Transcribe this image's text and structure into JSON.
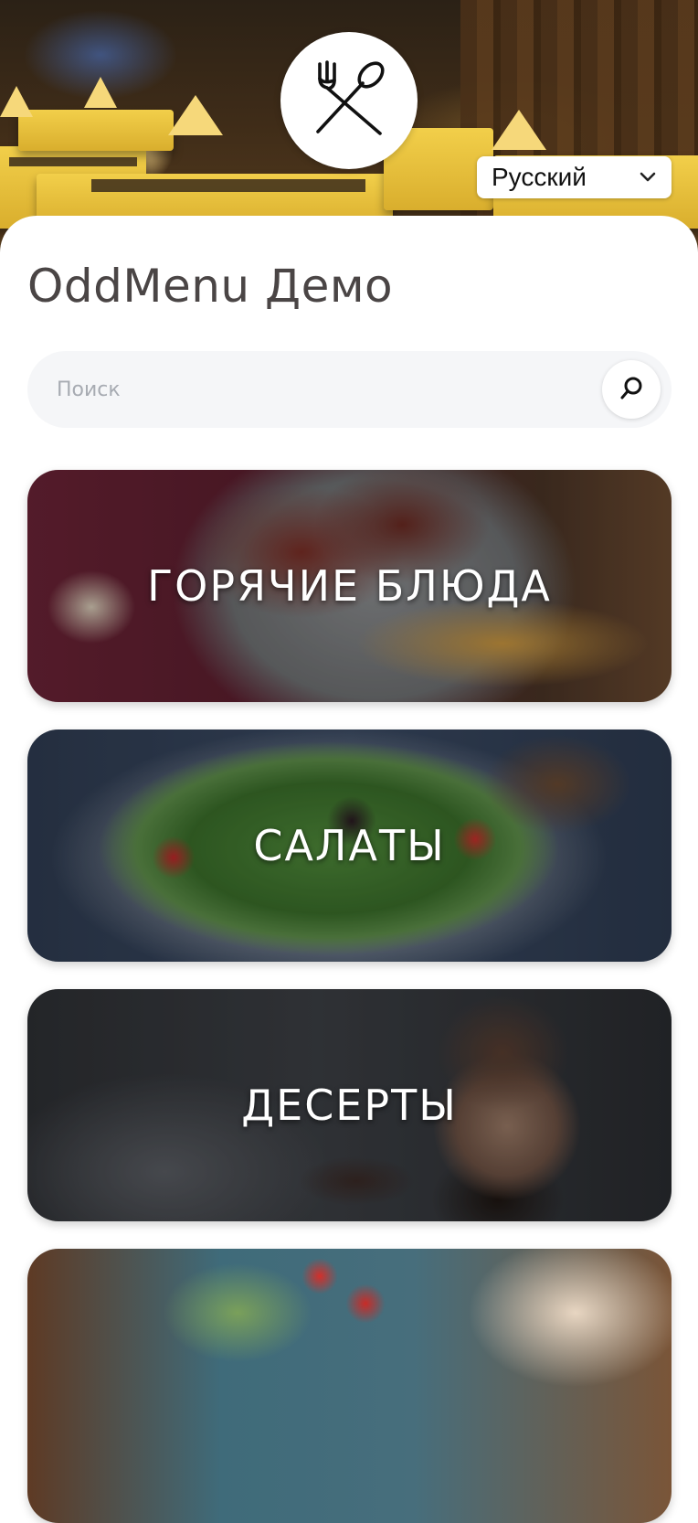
{
  "restaurant": {
    "name": "OddMenu Демо"
  },
  "logo": {
    "icon": "fork-and-spoon-icon"
  },
  "language": {
    "selected": "Русский",
    "icon": "chevron-down-icon"
  },
  "search": {
    "placeholder": "Поиск",
    "value": "",
    "icon": "search-icon"
  },
  "categories": [
    {
      "label": "ГОРЯЧИЕ БЛЮДА"
    },
    {
      "label": "САЛАТЫ"
    },
    {
      "label": "ДЕСЕРТЫ"
    },
    {
      "label": ""
    }
  ]
}
